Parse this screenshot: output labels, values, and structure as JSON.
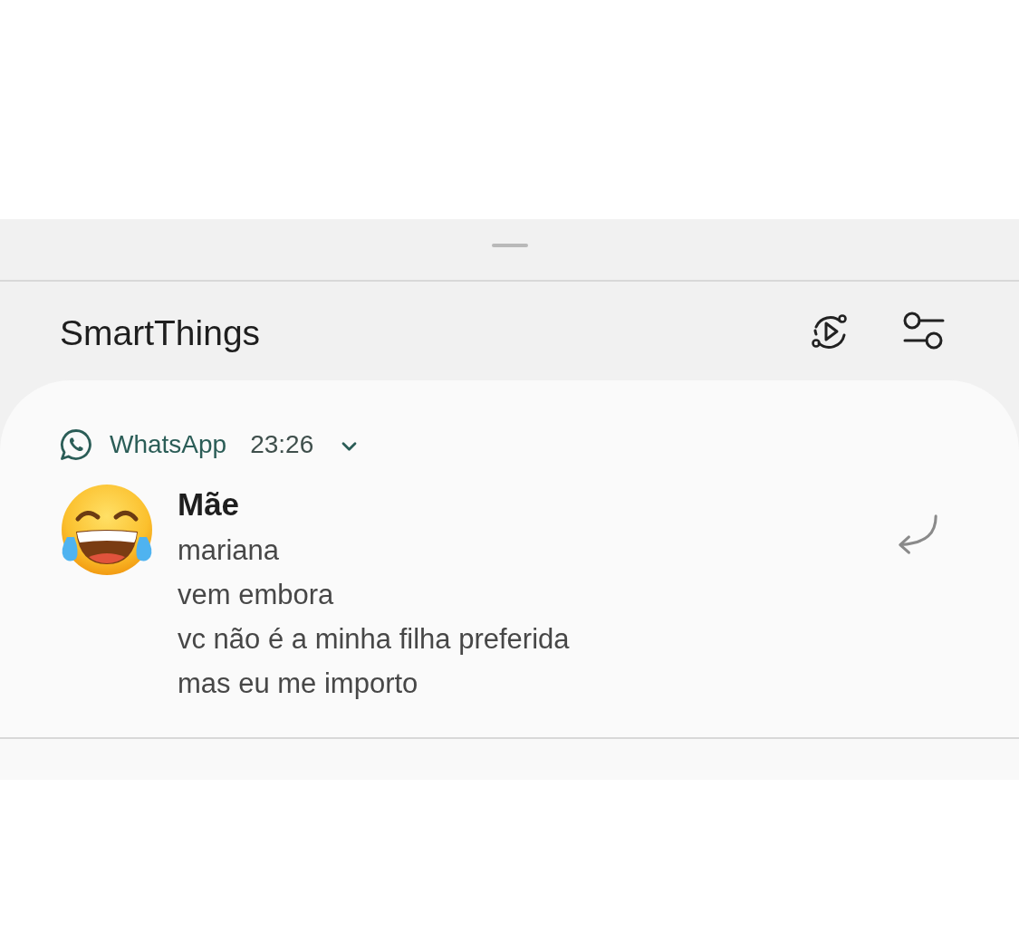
{
  "panel": {
    "title": "SmartThings"
  },
  "notification": {
    "app": "WhatsApp",
    "time": "23:26",
    "expanded": false,
    "sender": "Mãe",
    "messages": [
      "mariana",
      "vem embora",
      "vc não é a minha filha preferida",
      "mas eu me importo"
    ]
  }
}
